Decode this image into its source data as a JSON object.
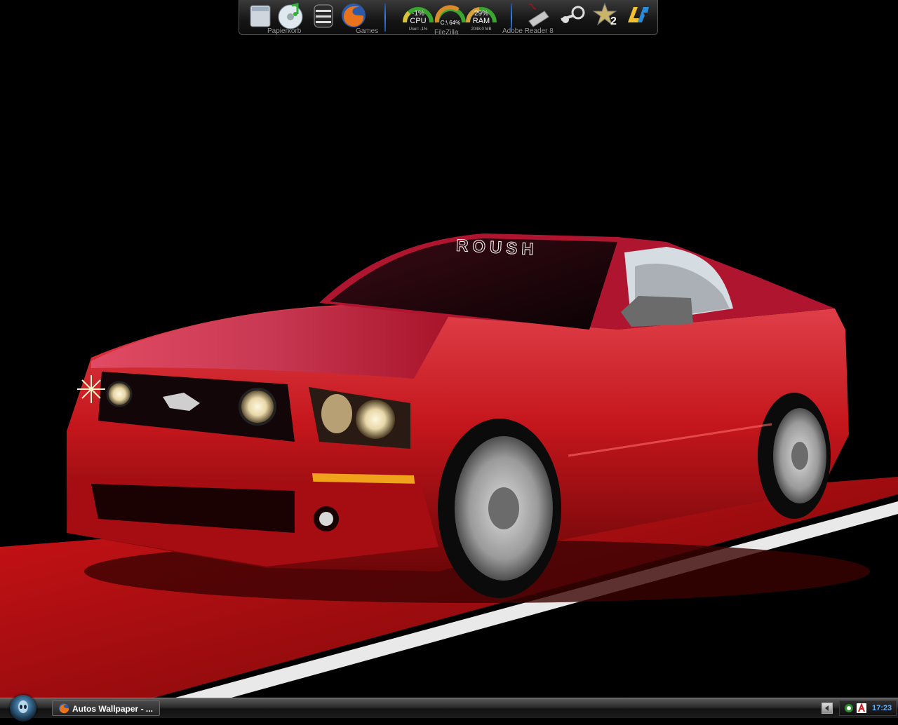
{
  "dock": {
    "items": [
      {
        "name": "recycle-bin",
        "label": "Papierkorb"
      },
      {
        "name": "music-player",
        "label": ""
      },
      {
        "name": "storage-drive",
        "label": ""
      },
      {
        "name": "firefox",
        "label": "Games"
      }
    ],
    "gauges": {
      "cpu": {
        "value": "-1%",
        "label": "CPU",
        "sub": "User: -1%"
      },
      "disk": {
        "value": "C:\\ 64%",
        "sub": "FileZilla"
      },
      "ram": {
        "value": "29%",
        "label": "RAM",
        "sub": "2048.0 MB"
      }
    },
    "right_items": [
      {
        "name": "adobe-reader",
        "label": "Adobe Reader 8"
      },
      {
        "name": "steam",
        "label": ""
      },
      {
        "name": "game-star",
        "label": "2"
      },
      {
        "name": "app-logo",
        "label": ""
      }
    ]
  },
  "wallpaper": {
    "windshield_text": "ROUSH"
  },
  "taskbar": {
    "task_label": "Autos Wallpaper - ...",
    "clock": "17:23"
  },
  "colors": {
    "car_red": "#c4161c",
    "floor_red": "#b10f12",
    "clock_blue": "#5fb0ff",
    "gauge_green": "#3aa62f"
  }
}
